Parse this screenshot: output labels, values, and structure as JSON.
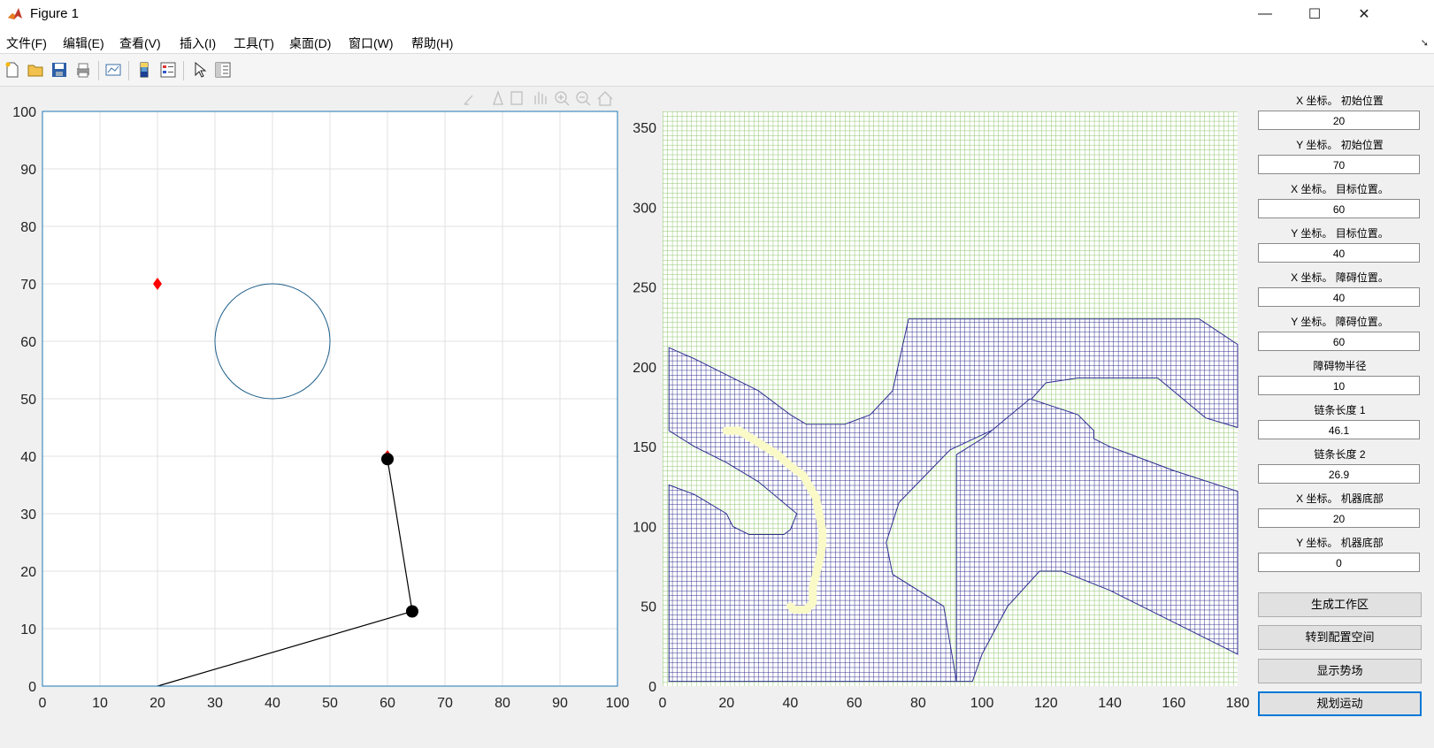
{
  "window": {
    "title": "Figure 1",
    "minimize": "—",
    "maximize": "☐",
    "close": "✕"
  },
  "menu": [
    "文件(F)",
    "编辑(E)",
    "查看(V)",
    "插入(I)",
    "工具(T)",
    "桌面(D)",
    "窗口(W)",
    "帮助(H)"
  ],
  "toolbar": [
    "new-figure-icon",
    "open-icon",
    "save-icon",
    "print-icon",
    "link-plot-icon",
    "colorbar-icon",
    "legend-icon",
    "edit-plot-arrow-icon",
    "property-inspector-icon"
  ],
  "axes_toolbar": [
    "brush-icon",
    "data-tip-icon",
    "save-axes-icon",
    "pan-icon",
    "zoom-in-icon",
    "zoom-out-icon",
    "home-icon"
  ],
  "colors": {
    "grid": "#e0e0e0",
    "axis_frame": "#1f77b4",
    "obstacle": "#1f5f8b",
    "start_marker": "#ff0000",
    "arm": "#000000",
    "cspace_free": "#8dc56b",
    "cspace_obstacle": "#2e2e8f",
    "path": "#fafac8"
  },
  "panel": {
    "fields": [
      {
        "label": "X 坐标。 初始位置",
        "value": "20"
      },
      {
        "label": "Y 坐标。 初始位置",
        "value": "70"
      },
      {
        "label": "X 坐标。 目标位置。",
        "value": "60"
      },
      {
        "label": "Y 坐标。 目标位置。",
        "value": "40"
      },
      {
        "label": "X 坐标。 障碍位置。",
        "value": "40"
      },
      {
        "label": "Y 坐标。 障碍位置。",
        "value": "60"
      },
      {
        "label": "障碍物半径",
        "value": "10"
      },
      {
        "label": "链条长度 1",
        "value": "46.1"
      },
      {
        "label": "链条长度 2",
        "value": "26.9"
      },
      {
        "label": "X 坐标。 机器底部",
        "value": "20"
      },
      {
        "label": "Y 坐标。 机器底部",
        "value": "0"
      }
    ],
    "buttons": [
      "生成工作区",
      "转到配置空间",
      "显示势场",
      "规划运动"
    ]
  },
  "chart_data": [
    {
      "type": "scatter",
      "title": "",
      "xlabel": "",
      "ylabel": "",
      "xlim": [
        0,
        100
      ],
      "ylim": [
        0,
        100
      ],
      "xticks": [
        0,
        10,
        20,
        30,
        40,
        50,
        60,
        70,
        80,
        90,
        100
      ],
      "yticks": [
        0,
        10,
        20,
        30,
        40,
        50,
        60,
        70,
        80,
        90,
        100
      ],
      "grid": true,
      "obstacle_circle": {
        "center": [
          40,
          60
        ],
        "radius": 10
      },
      "start_marker": {
        "x": 20,
        "y": 70,
        "shape": "diamond"
      },
      "goal_marker": {
        "x": 60,
        "y": 40,
        "shape": "diamond"
      },
      "arm": {
        "base": [
          20,
          0
        ],
        "joint": [
          64.3,
          13
        ],
        "end": [
          60,
          39.5
        ]
      }
    },
    {
      "type": "heatmap",
      "title": "",
      "xlabel": "",
      "ylabel": "",
      "xlim": [
        0,
        180
      ],
      "ylim": [
        0,
        360
      ],
      "xticks": [
        0,
        20,
        40,
        60,
        80,
        100,
        120,
        140,
        160,
        180
      ],
      "yticks": [
        0,
        50,
        100,
        150,
        200,
        250,
        300,
        350
      ],
      "grid": true,
      "obstacle_regions": [
        {
          "points": [
            [
              2,
              212
            ],
            [
              10,
              205
            ],
            [
              20,
              195
            ],
            [
              30,
              185
            ],
            [
              40,
              170
            ],
            [
              45,
              164
            ],
            [
              57,
              164
            ],
            [
              65,
              170
            ],
            [
              72,
              185
            ],
            [
              77,
              230
            ],
            [
              168,
              230
            ],
            [
              180,
              214
            ],
            [
              180,
              162
            ],
            [
              170,
              168
            ],
            [
              155,
              193
            ],
            [
              130,
              193
            ],
            [
              120,
              190
            ],
            [
              112,
              172
            ],
            [
              105,
              162
            ],
            [
              90,
              148
            ],
            [
              74,
              115
            ],
            [
              70,
              90
            ],
            [
              72,
              70
            ],
            [
              88,
              50
            ],
            [
              92,
              3
            ],
            [
              2,
              3
            ],
            [
              2,
              126
            ],
            [
              10,
              120
            ],
            [
              20,
              108
            ],
            [
              22,
              100
            ],
            [
              27,
              95
            ],
            [
              38,
              95
            ],
            [
              40,
              98
            ],
            [
              42,
              108
            ],
            [
              30,
              128
            ],
            [
              20,
              140
            ],
            [
              10,
              150
            ],
            [
              2,
              160
            ]
          ]
        },
        {
          "points": [
            [
              97,
              3
            ],
            [
              100,
              20
            ],
            [
              108,
              50
            ],
            [
              118,
              72
            ],
            [
              125,
              72
            ],
            [
              140,
              60
            ],
            [
              160,
              40
            ],
            [
              180,
              20
            ],
            [
              180,
              122
            ],
            [
              160,
              135
            ],
            [
              140,
              150
            ],
            [
              135,
              155
            ],
            [
              135,
              160
            ],
            [
              130,
              170
            ],
            [
              115,
              180
            ],
            [
              100,
              155
            ],
            [
              92,
              145
            ],
            [
              92,
              3
            ]
          ]
        }
      ],
      "path": [
        [
          20,
          160
        ],
        [
          24,
          160
        ],
        [
          28,
          155
        ],
        [
          32,
          150
        ],
        [
          36,
          145
        ],
        [
          40,
          138
        ],
        [
          44,
          132
        ],
        [
          46,
          125
        ],
        [
          48,
          118
        ],
        [
          49,
          108
        ],
        [
          50,
          98
        ],
        [
          50,
          88
        ],
        [
          49,
          78
        ],
        [
          48,
          70
        ],
        [
          47,
          62
        ],
        [
          47,
          52
        ],
        [
          45,
          48
        ],
        [
          41,
          48
        ],
        [
          40,
          50
        ]
      ]
    }
  ]
}
